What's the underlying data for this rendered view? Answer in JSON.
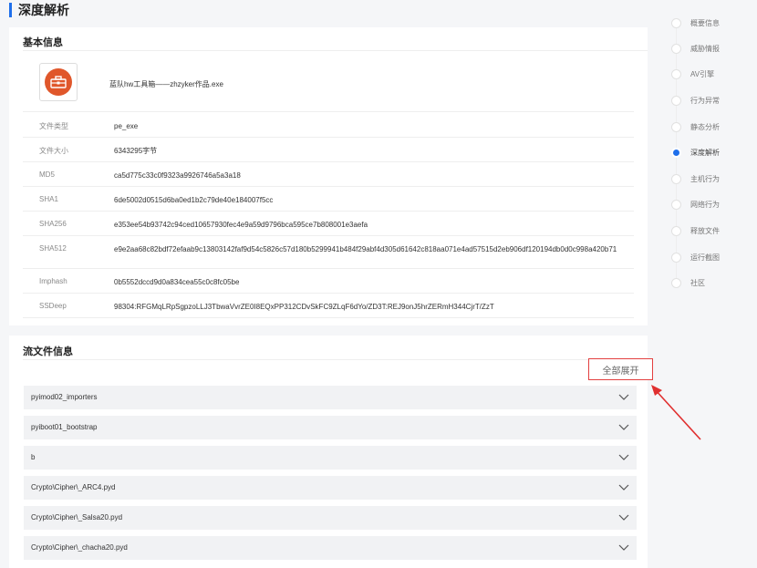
{
  "page": {
    "title": "深度解析"
  },
  "basic_info": {
    "title": "基本信息",
    "file_name": "蓝队hw工具箱——zhzyker作品.exe",
    "rows": [
      {
        "key": "文件类型",
        "value": "pe_exe"
      },
      {
        "key": "文件大小",
        "value": "6343295字节"
      },
      {
        "key": "MD5",
        "value": "ca5d775c33c0f9323a9926746a5a3a18"
      },
      {
        "key": "SHA1",
        "value": "6de5002d0515d6ba0ed1b2c79de40e184007f5cc"
      },
      {
        "key": "SHA256",
        "value": "e353ee54b93742c94ced10657930fec4e9a59d9796bca595ce7b808001e3aefa"
      },
      {
        "key": "SHA512",
        "value": "e9e2aa68c82bdf72efaab9c13803142faf9d54c5826c57d180b5299941b484f29abf4d305d61642c818aa071e4ad57515d2eb906df120194db0d0c998a420b71"
      },
      {
        "key": "Imphash",
        "value": "0b5552dccd9d0a834cea55c0c8fc05be"
      },
      {
        "key": "SSDeep",
        "value": "98304:RFGMqLRpSgpzoLLJ3TbwaVvrZE0I8EQxPP312CDvSkFC9ZLqF6dYo/ZD3T:REJ9onJ5hrZERmH344CjrT/ZzT"
      }
    ]
  },
  "stream_info": {
    "title": "流文件信息",
    "expand_all_label": "全部展开",
    "items": [
      "pyimod02_importers",
      "pyiboot01_bootstrap",
      "b",
      "Crypto\\Cipher\\_ARC4.pyd",
      "Crypto\\Cipher\\_Salsa20.pyd",
      "Crypto\\Cipher\\_chacha20.pyd"
    ]
  },
  "toc": {
    "items": [
      "概要信息",
      "威胁情报",
      "AV引擎",
      "行为异常",
      "静态分析",
      "深度解析",
      "主机行为",
      "网络行为",
      "释放文件",
      "运行截图",
      "社区"
    ],
    "active_index": 5
  },
  "colors": {
    "accent": "#1f6feb",
    "highlight": "#e34040",
    "file_icon": "#e0572b"
  },
  "icons": {
    "file": "toolbox-icon",
    "chevron": "chevron-down-icon",
    "annotation": "red-arrow-icon"
  }
}
